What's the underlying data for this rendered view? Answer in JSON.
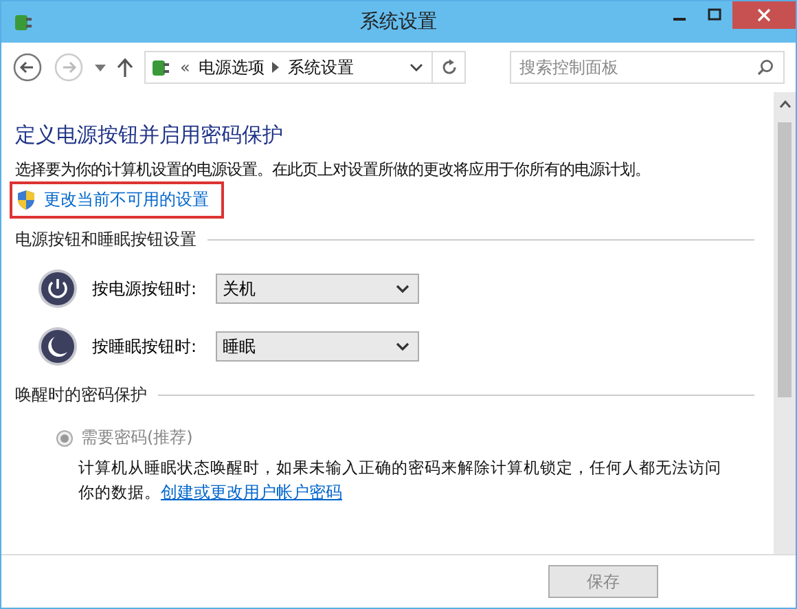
{
  "window": {
    "title": "系统设置"
  },
  "nav": {
    "breadcrumb_overflow": "«",
    "breadcrumb": [
      "电源选项",
      "系统设置"
    ],
    "search": {
      "placeholder": "搜索控制面板"
    }
  },
  "heading": "定义电源按钮并启用密码保护",
  "description": "选择要为你的计算机设置的电源设置。在此页上对设置所做的更改将应用于你所有的电源计划。",
  "elevate_link": "更改当前不可用的设置",
  "sections": [
    {
      "title": "电源按钮和睡眠按钮设置",
      "kind": "dropdowns",
      "rows": [
        {
          "kind": "power",
          "label": "按电源按钮时:",
          "value": "关机"
        },
        {
          "kind": "sleep",
          "label": "按睡眠按钮时:",
          "value": "睡眠"
        }
      ]
    },
    {
      "title": "唤醒时的密码保护",
      "kind": "radios",
      "options": [
        {
          "label": "需要密码(推荐)",
          "selected": true,
          "disabled": true,
          "description": "计算机从睡眠状态唤醒时，如果未输入正确的密码来解除计算机锁定，任何人都无法访问你的数据。",
          "link": "创建或更改用户帐户密码"
        }
      ]
    }
  ],
  "buttons": [
    "保存"
  ]
}
